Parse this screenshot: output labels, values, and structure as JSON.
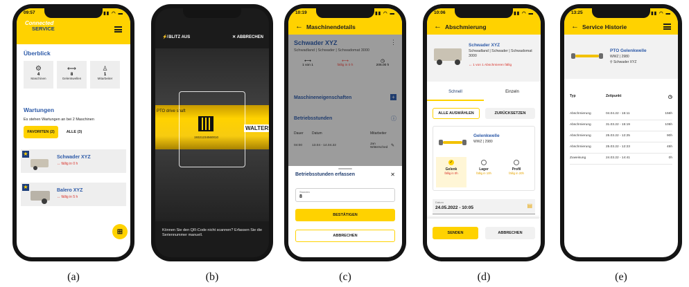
{
  "captions": [
    "(a)",
    "(b)",
    "(c)",
    "(d)",
    "(e)"
  ],
  "panel_a": {
    "time": "09:57",
    "logo_line1": "Connected",
    "logo_line2": "SERVICE",
    "overview_title": "Überblick",
    "stats": [
      {
        "icon": "gear-icon",
        "value": "4",
        "label": "Maschinen"
      },
      {
        "icon": "shaft-icon",
        "value": "8",
        "label": "Gelenkwellen"
      },
      {
        "icon": "person-icon",
        "value": "1",
        "label": "Mitarbeiter"
      }
    ],
    "maint_title": "Wartungen",
    "maint_text": "Es stehen Wartungen an bei 2 Maschinen",
    "tab_fav": "FAVORITEN (2)",
    "tab_all": "ALLE (3)",
    "machines": [
      {
        "name": "Schwader XYZ",
        "due": "↔ fällig in 0 h"
      },
      {
        "name": "Balero XYZ",
        "due": "↔ fällig in 5 h"
      }
    ]
  },
  "panel_b": {
    "flash": "BLITZ AUS",
    "cancel": "ABBRECHEN",
    "label_text": "PTO drive shaft",
    "brand": "WALTERS",
    "serial": "19321234560010",
    "hint": "Können Sie den QR-Code nicht scannen? Erfassen Sie die Seriennummer manuell."
  },
  "panel_c": {
    "time": "10:19",
    "header_title": "Maschinendetails",
    "machine_name": "Schwader XYZ",
    "machine_sub": "Schwadland | Schwader | Schwadomat 3000",
    "stats": [
      {
        "value": "1 von 1",
        "icon": "shaft-icon"
      },
      {
        "value": "fällig in 0 h",
        "icon": "alert-icon"
      },
      {
        "value": "206.00 h",
        "icon": "clock-icon"
      }
    ],
    "props_title": "Maschineneigenschaften",
    "hours_title": "Betriebsstunden",
    "col_duration": "Dauer",
    "col_date": "Datum",
    "col_staff": "Mitarbeiter",
    "row_duration": "04:00",
    "row_date": "13.04 - 14.04.22",
    "row_staff": "Jan Wittersched",
    "sheet_title": "Betriebsstunden erfassen",
    "field_label": "Stunden",
    "field_value": "8",
    "confirm": "BESTÄTIGEN",
    "abort": "ABBRECHEN"
  },
  "panel_d": {
    "time": "10:06",
    "header_title": "Abschmierung",
    "machine_name": "Schwader XYZ",
    "machine_sub": "Schwadland | Schwader | Schwadomat 3000",
    "machine_due": "↔ 1 von 1 Abschmieren fällig",
    "tab_fast": "Schnell",
    "tab_single": "Einzeln",
    "select_all": "ALLE AUSWÄHLEN",
    "reset": "ZURÜCKSETZEN",
    "shaft_name": "Gelenkwelle",
    "shaft_id": "WWZ | 2980",
    "points": [
      {
        "name": "Gelenk",
        "due": "fällig in 0h",
        "checked": true
      },
      {
        "name": "Lager",
        "due": "fällig in 10h",
        "checked": false
      },
      {
        "name": "Profil",
        "due": "fällig in 20h",
        "checked": false
      }
    ],
    "date_label": "Datum",
    "date_value": "24.05.2022 - 10:05",
    "send": "SENDEN",
    "abort": "ABBRECHEN"
  },
  "panel_e": {
    "time": "13:25",
    "header_title": "Service Historie",
    "shaft_name": "PTO Gelenkwelle",
    "shaft_id": "WWZ | 2980",
    "shaft_machine": "Schwader XYZ",
    "col_type": "Typ",
    "col_time": "Zeitpunkt",
    "rows": [
      {
        "type": "Abschmierung",
        "time": "04.04.22 - 15:11",
        "hours": "156h"
      },
      {
        "type": "Abschmierung",
        "time": "31.03.22 - 15:19",
        "hours": "105h"
      },
      {
        "type": "Abschmierung",
        "time": "25.03.22 - 12:25",
        "hours": "90h"
      },
      {
        "type": "Abschmierung",
        "time": "25.03.22 - 12:23",
        "hours": "45h"
      },
      {
        "type": "Zuweisung",
        "time": "24.03.22 - 14:41",
        "hours": "0h"
      }
    ]
  }
}
